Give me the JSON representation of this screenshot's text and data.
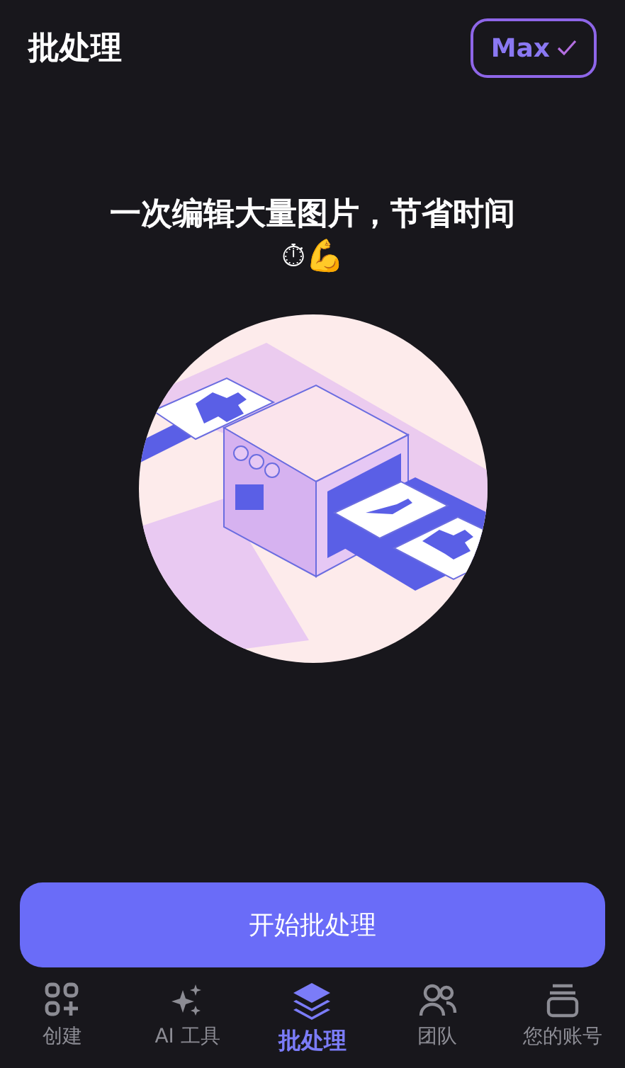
{
  "header": {
    "title": "批处理",
    "badge": {
      "label": "Max",
      "checked": true
    }
  },
  "headline": "一次编辑大量图片，节省时间",
  "headline_emoji": "⏱💪",
  "primary_button": "开始批处理",
  "tabs": [
    {
      "label": "创建",
      "kind": "create",
      "selected": false
    },
    {
      "label": "AI 工具",
      "kind": "ai",
      "selected": false
    },
    {
      "label": "批处理",
      "kind": "batch",
      "selected": true
    },
    {
      "label": "团队",
      "kind": "team",
      "selected": false
    },
    {
      "label": "您的账号",
      "kind": "account",
      "selected": false
    }
  ]
}
